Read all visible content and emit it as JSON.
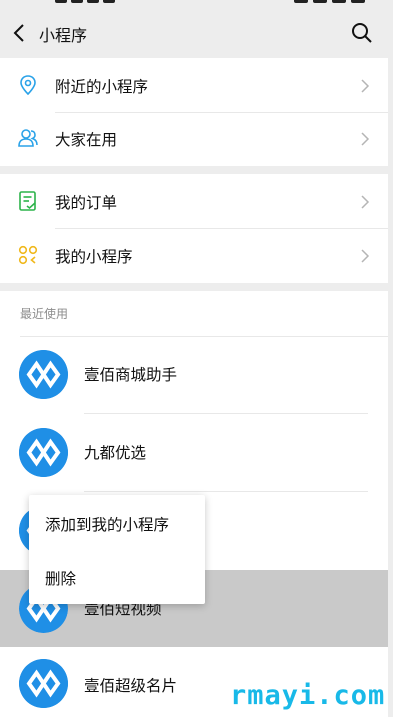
{
  "header": {
    "title": "小程序"
  },
  "menu_rows_top": [
    {
      "label": "附近的小程序"
    },
    {
      "label": "大家在用"
    }
  ],
  "menu_rows_mid": [
    {
      "label": "我的订单"
    },
    {
      "label": "我的小程序"
    }
  ],
  "recent": {
    "section_label": "最近使用",
    "apps": [
      {
        "name": "壹佰商城助手"
      },
      {
        "name": "九都优选"
      },
      {
        "name": ""
      },
      {
        "name": "壹佰短视频"
      },
      {
        "name": "壹佰超级名片"
      }
    ]
  },
  "context_menu": {
    "items": [
      {
        "label": "添加到我的小程序"
      },
      {
        "label": "删除"
      }
    ]
  },
  "watermark": "rmayi.com",
  "colors": {
    "accent": "#1f8fe6",
    "background": "#ededed",
    "watermark": "#18b9e8"
  }
}
